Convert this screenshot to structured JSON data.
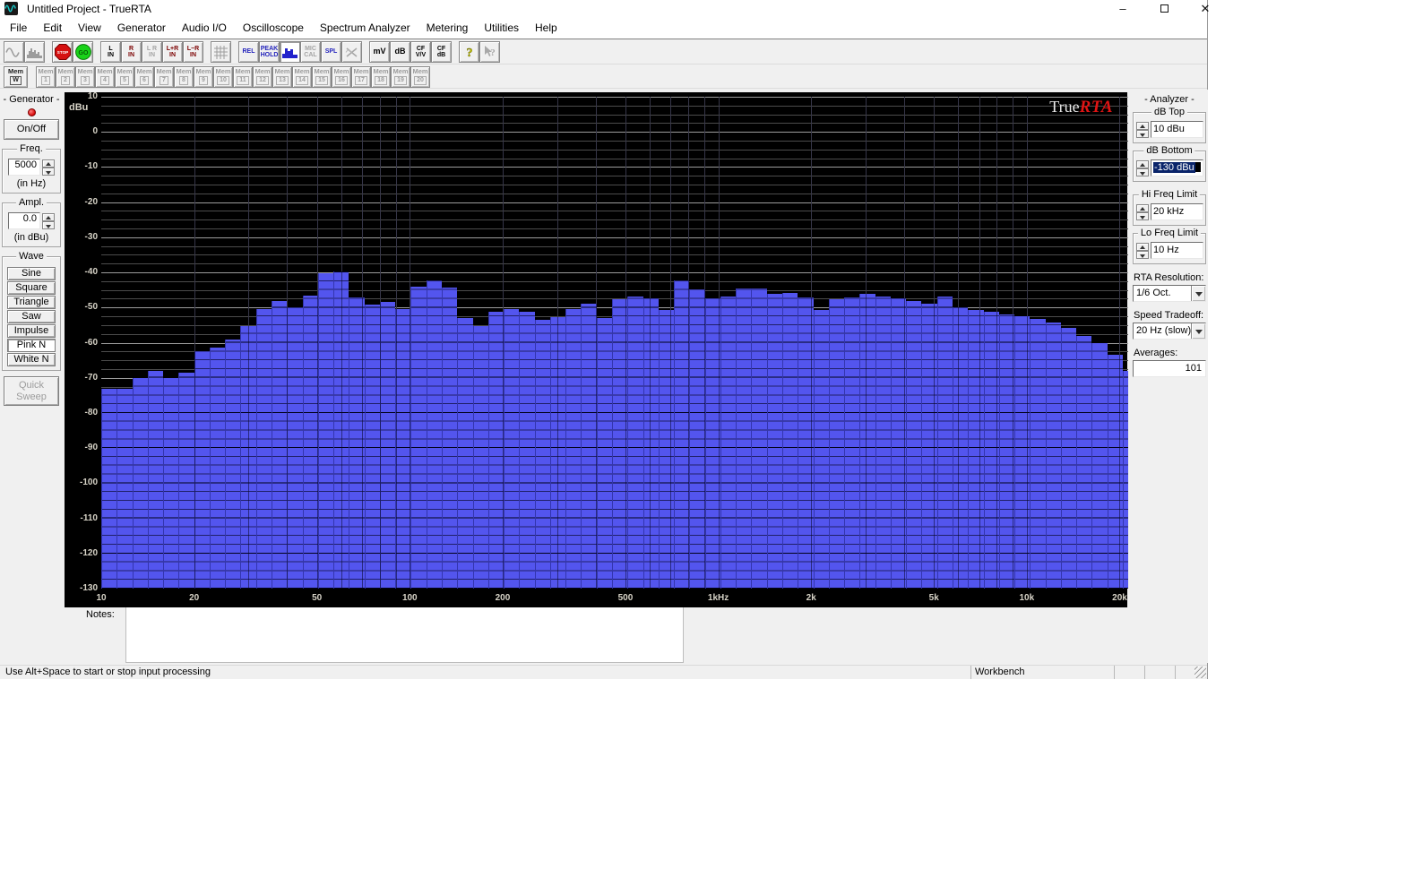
{
  "window": {
    "title": "Untitled Project - TrueRTA",
    "minimize": "–",
    "close": "✕"
  },
  "menu": {
    "items": [
      "File",
      "Edit",
      "View",
      "Generator",
      "Audio I/O",
      "Oscilloscope",
      "Spectrum Analyzer",
      "Metering",
      "Utilities",
      "Help"
    ]
  },
  "toolbar": {
    "buttons": [
      {
        "name": "generator-wave-icon-button",
        "icon": "sine",
        "state": "disabled"
      },
      {
        "name": "analyzer-display-icon-button",
        "icon": "spectrum-gray",
        "state": "disabled"
      },
      {
        "name": "stop-button",
        "icon": "stop",
        "label": "STOP",
        "gap": true
      },
      {
        "name": "go-button",
        "icon": "go",
        "label": "GO"
      },
      {
        "name": "left-input-button",
        "lines": [
          "L",
          "IN"
        ],
        "color": "#000000",
        "gap": true
      },
      {
        "name": "right-input-button",
        "lines": [
          "R",
          "IN"
        ],
        "color": "#7b0000"
      },
      {
        "name": "stereo-input-button",
        "lines": [
          "L R",
          "IN"
        ],
        "state": "disabled"
      },
      {
        "name": "l-plus-r-input-button",
        "lines": [
          "L+R",
          "IN"
        ],
        "color": "#7b0000"
      },
      {
        "name": "l-minus-r-input-button",
        "lines": [
          "L−R",
          "IN"
        ],
        "color": "#7b0000"
      },
      {
        "name": "grid-toggle-button",
        "icon": "grid",
        "state": "disabled",
        "gap": true
      },
      {
        "name": "relative-mode-button",
        "lines": [
          "REL"
        ],
        "color": "#2424bc",
        "gap": true
      },
      {
        "name": "peak-hold-button",
        "lines": [
          "PEAK",
          "HOLD"
        ],
        "color": "#2424bc"
      },
      {
        "name": "bar-display-button",
        "icon": "spectrum-blue",
        "state": "pressed"
      },
      {
        "name": "mic-cal-button",
        "lines": [
          "MIC",
          "CAL"
        ],
        "state": "disabled"
      },
      {
        "name": "spl-button",
        "lines": [
          "SPL"
        ],
        "color": "#2424bc"
      },
      {
        "name": "crossover-button",
        "icon": "x-gray",
        "state": "disabled"
      },
      {
        "name": "millivolts-button",
        "lines": [
          "mV"
        ],
        "gap": true
      },
      {
        "name": "decibels-button",
        "lines": [
          "dB"
        ]
      },
      {
        "name": "crest-factor-vv-button",
        "lines": [
          "CF",
          "V/V"
        ]
      },
      {
        "name": "crest-factor-db-button",
        "lines": [
          "CF",
          "dB"
        ]
      },
      {
        "name": "help-button",
        "icon": "help",
        "gap": true
      },
      {
        "name": "context-help-button",
        "icon": "help-arrow",
        "state": "disabled"
      }
    ]
  },
  "memory_bar": {
    "master": {
      "line1": "Mem",
      "num": "W"
    },
    "slot_label": "Mem",
    "slots": [
      "1",
      "2",
      "3",
      "4",
      "5",
      "6",
      "7",
      "8",
      "9",
      "10",
      "11",
      "12",
      "13",
      "14",
      "15",
      "16",
      "17",
      "18",
      "19",
      "20"
    ]
  },
  "generator": {
    "panel_title": "- Generator -",
    "power_label": "On/Off",
    "freq": {
      "legend": "Freq.",
      "value": "5000",
      "unit": "(in Hz)"
    },
    "ampl": {
      "legend": "Ampl.",
      "value": "0.0",
      "unit": "(in dBu)"
    },
    "wave": {
      "legend": "Wave",
      "options": [
        "Sine",
        "Square",
        "Triangle",
        "Saw",
        "Impulse",
        "Pink N",
        "White N"
      ],
      "selected": "Pink N"
    },
    "quick_sweep": {
      "line1": "Quick",
      "line2": "Sweep",
      "enabled": false
    }
  },
  "analyzer": {
    "panel_title": "- Analyzer -",
    "db_top": {
      "legend": "dB Top",
      "value": "10 dBu"
    },
    "db_bottom": {
      "legend": "dB Bottom",
      "value": "-130 dBu",
      "selected": true,
      "selection_color": "#0a246a"
    },
    "hi_freq": {
      "legend": "Hi Freq Limit",
      "value": "20 kHz"
    },
    "lo_freq": {
      "legend": "Lo Freq Limit",
      "value": "10 Hz"
    },
    "rta_resolution": {
      "label": "RTA Resolution:",
      "value": "1/6 Oct."
    },
    "speed_tradeoff": {
      "label": "Speed Tradeoff:",
      "value": "20 Hz (slow)"
    },
    "averages": {
      "label": "Averages:",
      "value": "101"
    }
  },
  "chart_data": {
    "type": "bar",
    "title_word1": "True",
    "title_word2": "RTA",
    "ylabel": "dBu",
    "ylim": [
      -130,
      10
    ],
    "y_major_step": 10,
    "y_minor_step": 2.5,
    "x_scale": "log",
    "x_range_hz": [
      10,
      20000
    ],
    "x_ticks": [
      [
        "10",
        10
      ],
      [
        "20",
        20
      ],
      [
        "50",
        50
      ],
      [
        "100",
        100
      ],
      [
        "200",
        200
      ],
      [
        "500",
        500
      ],
      [
        "1kHz",
        1000
      ],
      [
        "2k",
        2000
      ],
      [
        "5k",
        5000
      ],
      [
        "10k",
        10000
      ],
      [
        "20k",
        20000
      ]
    ],
    "resolution": "1/6 octave",
    "plot_bg": "#000000",
    "bar_color": "#5355ee",
    "band_center_freqs_hz": [
      10.6,
      11.9,
      13.3,
      15,
      16.8,
      18.9,
      21.2,
      23.8,
      26.7,
      30,
      33.6,
      37.8,
      42.4,
      47.6,
      53.4,
      59.9,
      67.3,
      75.5,
      84.8,
      95.1,
      106.8,
      119.9,
      134.5,
      151,
      169.5,
      190.3,
      213.6,
      239.7,
      269.1,
      302,
      339,
      380.6,
      427.2,
      479.5,
      538.2,
      604.1,
      678,
      761.1,
      854.3,
      958.9,
      1076,
      1208,
      1356,
      1522,
      1709,
      1918,
      2153,
      2416,
      2712,
      3044,
      3417,
      3836,
      4305,
      4833,
      5424,
      6089,
      6834,
      7671,
      8611,
      9665,
      10849,
      12177,
      13669,
      15343,
      17222,
      19331,
      21698
    ],
    "values_dbu": [
      -73,
      -73,
      -70,
      -68,
      -70,
      -68.5,
      -62.5,
      -61.5,
      -59,
      -55.3,
      -50.3,
      -48.2,
      -50,
      -46.7,
      -40.3,
      -39.8,
      -47,
      -49.2,
      -48.4,
      -50.3,
      -44.1,
      -42.3,
      -44.4,
      -52.9,
      -55.3,
      -51.2,
      -50.3,
      -51.2,
      -53.6,
      -52.6,
      -50.5,
      -48.9,
      -53.1,
      -47.5,
      -46.9,
      -47.4,
      -50.8,
      -42.3,
      -44.8,
      -47.4,
      -46.8,
      -44.6,
      -44.6,
      -46.1,
      -45.9,
      -47.1,
      -50.6,
      -47.6,
      -47.2,
      -46.1,
      -46.9,
      -47.4,
      -48.2,
      -48.9,
      -46.8,
      -49.9,
      -50.8,
      -51.2,
      -51.9,
      -52.5,
      -53.3,
      -54.2,
      -55.7,
      -58,
      -60,
      -63.4,
      -68
    ]
  },
  "notes": {
    "label": "Notes:",
    "value": ""
  },
  "status": {
    "message": "Use Alt+Space to start or stop input processing",
    "workbench": "Workbench"
  }
}
